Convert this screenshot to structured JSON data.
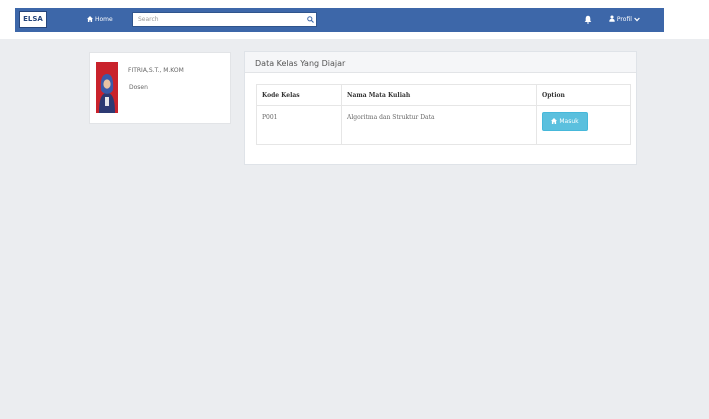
{
  "navbar": {
    "brand": "ELSA",
    "home_label": "Home",
    "search_placeholder": "Search",
    "profile_label": "Profil"
  },
  "profile_card": {
    "name": "FITRIA,S.T., M.KOM",
    "role": "Dosen"
  },
  "main_panel": {
    "title": "Data Kelas Yang Diajar",
    "table": {
      "headers": [
        "Kode Kelas",
        "Nama Mata Kuliah",
        "Option"
      ],
      "rows": [
        {
          "kode": "P001",
          "nama": "Algoritma dan Struktur Data",
          "button_label": "Masuk"
        }
      ]
    }
  },
  "colors": {
    "navbar": "#3d67a9",
    "button": "#5bc0de",
    "background": "#ebedf0"
  }
}
